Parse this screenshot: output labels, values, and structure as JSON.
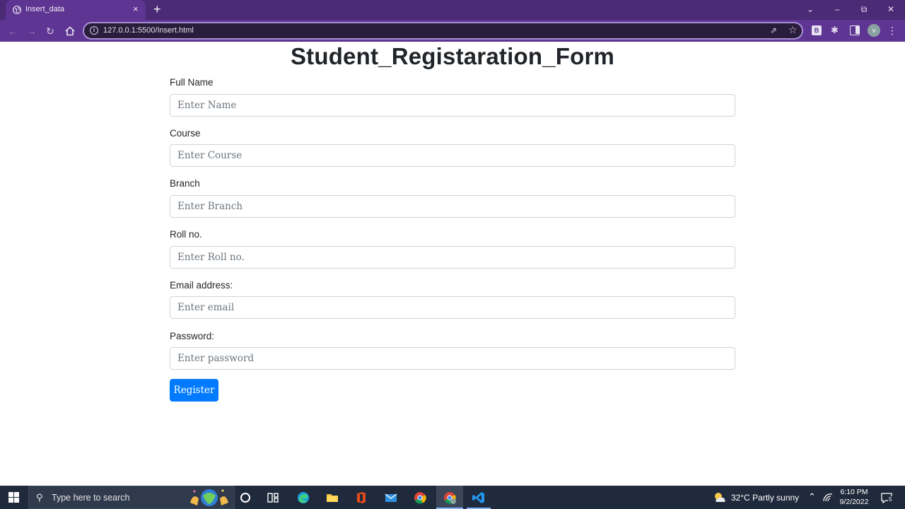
{
  "browser": {
    "tab_title": "Insert_data",
    "tab_close": "×",
    "new_tab": "+",
    "url": "127.0.0.1:5500/Insert.html",
    "avatar_letter": "v",
    "ext_b_label": "B"
  },
  "form": {
    "title": "Student_Registaration_Form",
    "fields": [
      {
        "label": "Full Name",
        "placeholder": "Enter Name"
      },
      {
        "label": "Course",
        "placeholder": "Enter Course"
      },
      {
        "label": "Branch",
        "placeholder": "Enter Branch"
      },
      {
        "label": "Roll no.",
        "placeholder": "Enter Roll no."
      },
      {
        "label": "Email address:",
        "placeholder": "Enter email"
      },
      {
        "label": "Password:",
        "placeholder": "Enter password"
      }
    ],
    "submit_label": "Register"
  },
  "taskbar": {
    "search_placeholder": "Type here to search",
    "weather": "32°C  Partly sunny",
    "time": "6:10 PM",
    "date": "9/2/2022",
    "notification_count": "5"
  },
  "colors": {
    "chrome_tabstrip": "#4b2a76",
    "chrome_toolbar": "#5e3592",
    "primary_button": "#007bff",
    "taskbar": "#1f2a3c"
  },
  "icons": [
    "globe-icon",
    "back-icon",
    "forward-icon",
    "reload-icon",
    "home-icon",
    "info-icon",
    "share-icon",
    "star-icon",
    "puzzle-icon",
    "side-panel-icon",
    "menu-icon",
    "windows-icon",
    "search-icon",
    "cortana-icon",
    "task-view-icon",
    "edge-icon",
    "file-explorer-icon",
    "office-icon",
    "mail-icon",
    "chrome-icon",
    "vscode-icon",
    "weather-icon",
    "notification-icon"
  ]
}
